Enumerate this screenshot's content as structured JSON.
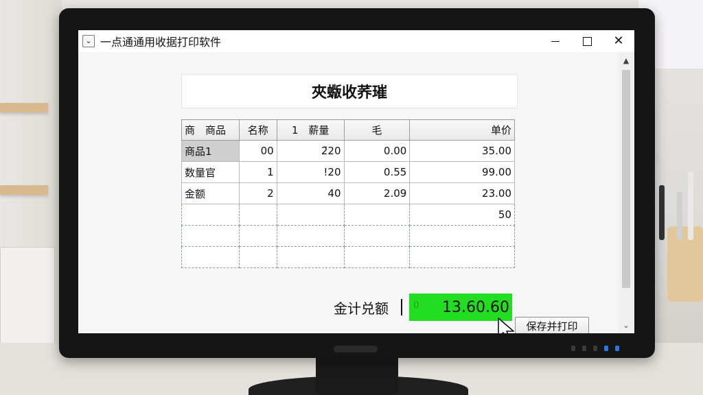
{
  "window": {
    "title": "一点通通用收据打印软件",
    "app_icon": "chevron-down-icon",
    "controls": [
      "minimize",
      "maximize",
      "close"
    ]
  },
  "form": {
    "heading": "夾蝂收荞璀",
    "table": {
      "headers": [
        "商　商品",
        "名称",
        "1　薪量",
        "毛",
        "单价"
      ],
      "rows": [
        [
          "商品1",
          "00",
          "2̈20",
          "0.00",
          "35.00"
        ],
        [
          "数量官",
          "1",
          "!20",
          "0.55",
          "99.00"
        ],
        [
          "金额",
          "2",
          "40",
          "2.09",
          "23.00"
        ],
        [
          "",
          "",
          "",
          "",
          "50"
        ],
        [
          "",
          "",
          "",
          "",
          ""
        ],
        [
          "",
          "",
          "",
          "",
          ""
        ]
      ]
    },
    "total_label": "金计兑额",
    "total_value": "13.60.60",
    "total_ghost": "0",
    "print_button": "保存并打印"
  },
  "colors": {
    "total_highlight": "#22dd22",
    "window_bg": "#f4f4f4"
  }
}
